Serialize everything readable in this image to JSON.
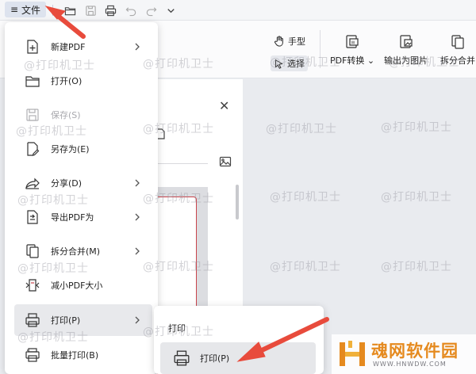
{
  "topbar": {
    "file_label": "文件",
    "menu_icon": "≡"
  },
  "ribbon": {
    "hand_label": "手型",
    "select_label": "选择",
    "pdf_convert_label": "PDF转换",
    "export_image_label": "输出为图片",
    "split_merge_label": "拆分合并"
  },
  "file_menu": {
    "items": [
      {
        "label": "新建PDF",
        "icon": "new-pdf-icon",
        "submenu": true,
        "disabled": false
      },
      {
        "label": "打开(O)",
        "icon": "folder-open-icon",
        "submenu": false,
        "disabled": false
      },
      {
        "label": "保存(S)",
        "icon": "save-icon",
        "submenu": false,
        "disabled": true
      },
      {
        "label": "另存为(E)",
        "icon": "save-as-icon",
        "submenu": false,
        "disabled": false
      },
      {
        "label": "分享(D)",
        "icon": "share-icon",
        "submenu": true,
        "disabled": false
      },
      {
        "label": "导出PDF为",
        "icon": "export-pdf-icon",
        "submenu": true,
        "disabled": false
      },
      {
        "label": "拆分合并(M)",
        "icon": "split-merge-icon",
        "submenu": true,
        "disabled": false
      },
      {
        "label": "减小PDF大小",
        "icon": "compress-pdf-icon",
        "submenu": false,
        "disabled": false
      },
      {
        "label": "打印(P)",
        "icon": "printer-icon",
        "submenu": true,
        "disabled": false
      },
      {
        "label": "批量打印(B)",
        "icon": "batch-print-icon",
        "submenu": false,
        "disabled": false
      }
    ]
  },
  "submenu": {
    "title": "打印",
    "print_label": "打印(P)"
  },
  "watermark_text": "@打印机卫士",
  "logo": {
    "text": "魂网软件园",
    "url": "WWW.HNWDW.COM"
  },
  "colors": {
    "arrow": "#e84b3c",
    "logo_orange": "#e58a1f",
    "thumb_border": "#c9434b"
  }
}
